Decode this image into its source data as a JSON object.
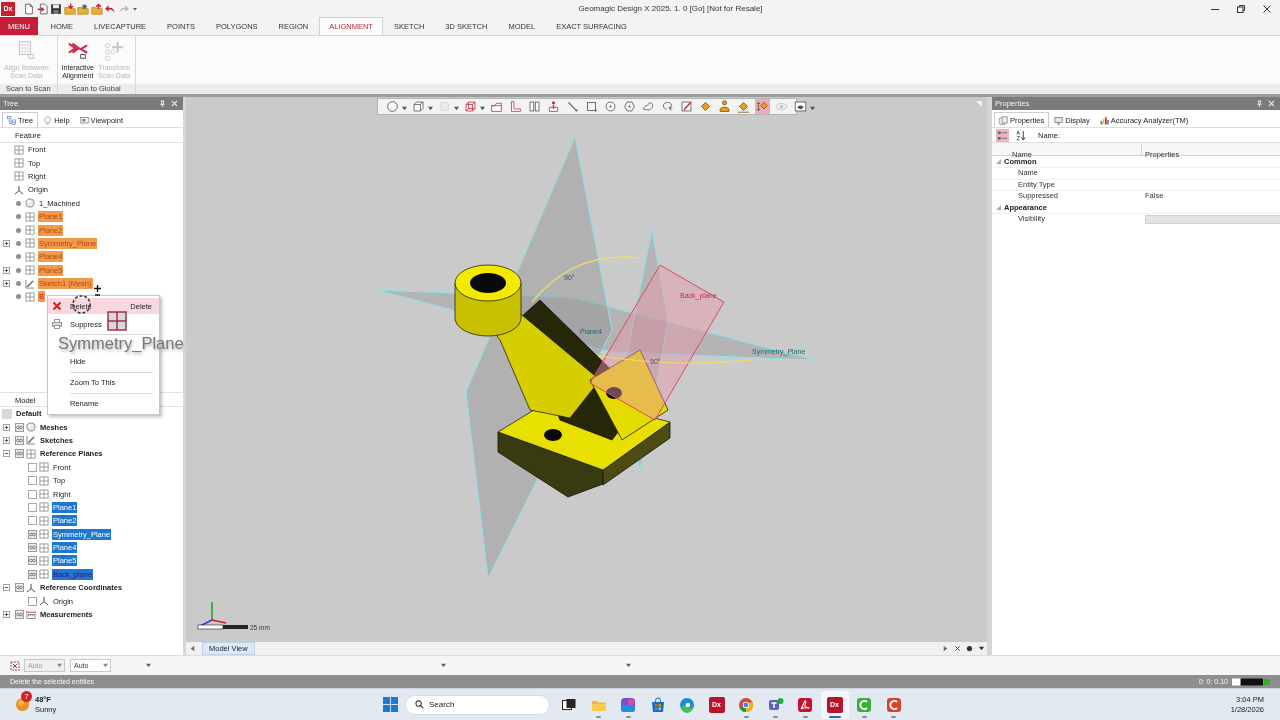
{
  "title_bar": {
    "app_badge": "Dx",
    "quick_access": [
      {
        "kind": "new",
        "disabled": false
      },
      {
        "kind": "import",
        "disabled": false
      },
      {
        "kind": "save",
        "disabled": false
      },
      {
        "kind": "folderin",
        "disabled": false
      },
      {
        "kind": "folderopen",
        "disabled": false
      },
      {
        "kind": "folderout",
        "disabled": false
      },
      {
        "kind": "undo",
        "disabled": false
      },
      {
        "kind": "redo",
        "disabled": true
      },
      {
        "kind": "customize",
        "disabled": false
      }
    ],
    "title": "Geomagic Design X 2025. 1. 0 [Go] [Not for Resale]"
  },
  "ribbon": {
    "tabs": [
      {
        "label": "MENU",
        "kind": "menu",
        "selected": false
      },
      {
        "label": "HOME",
        "kind": "tab",
        "selected": false
      },
      {
        "label": "LIVECAPTURE",
        "kind": "tab",
        "selected": false
      },
      {
        "label": "POINTS",
        "kind": "tab",
        "selected": false
      },
      {
        "label": "POLYGONS",
        "kind": "tab",
        "selected": false
      },
      {
        "label": "REGION",
        "kind": "tab",
        "selected": false
      },
      {
        "label": "ALIGNMENT",
        "kind": "tab",
        "selected": true
      },
      {
        "label": "SKETCH",
        "kind": "tab",
        "selected": false
      },
      {
        "label": "3D SKETCH",
        "kind": "tab",
        "selected": false
      },
      {
        "label": "MODEL",
        "kind": "tab",
        "selected": false
      },
      {
        "label": "EXACT SURFACING",
        "kind": "tab",
        "selected": false
      }
    ],
    "groups": [
      {
        "label": "Scan to Scan",
        "buttons": [
          {
            "kind": "grid",
            "lines": [
              "Align Between",
              "Scan Data"
            ],
            "disabled": true
          }
        ]
      },
      {
        "label": "Scan to Global",
        "buttons": [
          {
            "kind": "arrows",
            "lines": [
              "Interactive",
              "Alignment"
            ],
            "disabled": false
          },
          {
            "kind": "move",
            "lines": [
              "Transform",
              "Scan Data"
            ],
            "disabled": true
          }
        ]
      }
    ]
  },
  "tree_panel": {
    "title": "Tree",
    "tabs": [
      {
        "label": "Tree",
        "kind": "tree",
        "selected": true
      },
      {
        "label": "Help",
        "kind": "help",
        "selected": false
      },
      {
        "label": "Viewpoint",
        "kind": "viewpoint",
        "selected": false
      }
    ],
    "feature_heading": "Feature",
    "features": [
      {
        "label": "Front",
        "kind": "plane",
        "status_dot": false,
        "selected": false,
        "current": false
      },
      {
        "label": "Top",
        "kind": "plane",
        "status_dot": false,
        "selected": false,
        "current": false
      },
      {
        "label": "Right",
        "kind": "plane",
        "status_dot": false,
        "selected": false,
        "current": false
      },
      {
        "label": "Origin",
        "kind": "origin",
        "status_dot": false,
        "selected": false,
        "current": false
      },
      {
        "label": "1_Machined",
        "kind": "mesh",
        "status_dot": true,
        "selected": false,
        "current": false
      },
      {
        "label": "Plane1",
        "kind": "plane",
        "status_dot": true,
        "selected": true,
        "current": false
      },
      {
        "label": "Plane2",
        "kind": "plane",
        "status_dot": true,
        "selected": true,
        "current": false
      },
      {
        "label": "Symmetry_Plane",
        "kind": "plane",
        "status_dot": true,
        "expanded": false,
        "selected": true,
        "current": false
      },
      {
        "label": "Plane4",
        "kind": "plane",
        "status_dot": true,
        "selected": true,
        "current": false
      },
      {
        "label": "Plane5",
        "kind": "plane",
        "status_dot": true,
        "expanded": false,
        "selected": true,
        "current": false
      },
      {
        "label": "Sketch1 (Mesh)",
        "kind": "sketch",
        "status_dot": true,
        "expanded": false,
        "selected": true,
        "current": false
      },
      {
        "label": "B",
        "kind": "plane",
        "status_dot": true,
        "selected": true,
        "current": true
      }
    ],
    "model_heading": "Model",
    "model_root": "Default",
    "model_tree": [
      {
        "label": "Meshes",
        "kind": "mesh",
        "expanded": false,
        "visible": true,
        "selected": false
      },
      {
        "label": "Sketches",
        "kind": "sketch",
        "expanded": false,
        "visible": true,
        "selected": false
      },
      {
        "label": "Reference Planes",
        "kind": "plane",
        "expanded": true,
        "visible": true,
        "selected": false,
        "children": [
          {
            "label": "Front",
            "kind": "plane",
            "visible": false,
            "selected": false,
            "current": false
          },
          {
            "label": "Top",
            "kind": "plane",
            "visible": false,
            "selected": false,
            "current": false
          },
          {
            "label": "Right",
            "kind": "plane",
            "visible": false,
            "selected": false,
            "current": false
          },
          {
            "label": "Plane1",
            "kind": "plane",
            "visible": false,
            "selected": true,
            "current": false
          },
          {
            "label": "Plane2",
            "kind": "plane",
            "visible": false,
            "selected": true,
            "current": false
          },
          {
            "label": "Symmetry_Plane",
            "kind": "plane",
            "visible": true,
            "selected": true,
            "current": false
          },
          {
            "label": "Plane4",
            "kind": "plane",
            "visible": true,
            "selected": true,
            "current": false
          },
          {
            "label": "Plane5",
            "kind": "plane",
            "visible": true,
            "selected": true,
            "current": false
          },
          {
            "label": "Back_plane",
            "kind": "plane",
            "visible": true,
            "selected": true,
            "current": true
          }
        ]
      },
      {
        "label": "Reference Coordinates",
        "kind": "origin",
        "expanded": true,
        "visible": true,
        "selected": false,
        "children": [
          {
            "label": "Origin",
            "kind": "origin",
            "visible": false,
            "selected": false,
            "current": false
          }
        ]
      },
      {
        "label": "Measurements",
        "kind": "measure",
        "expanded": false,
        "visible": true,
        "selected": false
      }
    ]
  },
  "context_menu": {
    "items": [
      {
        "kind": "delete",
        "label": "Delete",
        "shortcut": "Delete",
        "highlighted": true,
        "separator": false
      },
      {
        "kind": "suppress",
        "label": "Suppress",
        "highlighted": false,
        "separator": false
      },
      {
        "kind": "plain",
        "label": "Hide",
        "highlighted": false,
        "separator": true
      },
      {
        "kind": "plain",
        "label": "Zoom To This",
        "highlighted": false,
        "separator": true
      },
      {
        "kind": "plain",
        "label": "Rename",
        "highlighted": false,
        "separator": true
      }
    ]
  },
  "drag_ghost": {
    "label": "Symmetry_Plane"
  },
  "viewport": {
    "toolbar": [
      {
        "kind": "sphere",
        "dropdown": true,
        "selected": false,
        "disabled": false
      },
      {
        "kind": "cube",
        "dropdown": true,
        "selected": false,
        "disabled": false
      },
      {
        "kind": "surface",
        "dropdown": true,
        "selected": false,
        "disabled": true
      },
      {
        "kind": "wireframe",
        "dropdown": true,
        "selected": false,
        "disabled": false
      },
      {
        "kind": "front",
        "dropdown": false,
        "selected": false,
        "disabled": false
      },
      {
        "kind": "top",
        "dropdown": false,
        "selected": false,
        "disabled": false
      },
      {
        "kind": "side",
        "dropdown": false,
        "selected": false,
        "disabled": false
      },
      {
        "kind": "normal",
        "dropdown": false,
        "selected": false,
        "disabled": false
      },
      {
        "kind": "line",
        "dropdown": false,
        "selected": false,
        "disabled": false
      },
      {
        "kind": "rectangle",
        "dropdown": false,
        "selected": false,
        "disabled": false
      },
      {
        "kind": "circle",
        "dropdown": false,
        "selected": false,
        "disabled": false
      },
      {
        "kind": "hexagon",
        "dropdown": false,
        "selected": false,
        "disabled": false
      },
      {
        "kind": "freeform",
        "dropdown": false,
        "selected": false,
        "disabled": false
      },
      {
        "kind": "lasso",
        "dropdown": false,
        "selected": false,
        "disabled": false
      },
      {
        "kind": "brush",
        "dropdown": false,
        "selected": false,
        "disabled": false
      },
      {
        "kind": "bucket",
        "dropdown": false,
        "selected": false,
        "disabled": false
      },
      {
        "kind": "bucketperson",
        "dropdown": false,
        "selected": false,
        "disabled": false
      },
      {
        "kind": "bucketline",
        "dropdown": false,
        "selected": false,
        "disabled": false
      },
      {
        "kind": "bucketarrows",
        "dropdown": false,
        "selected": true,
        "disabled": false
      },
      {
        "kind": "eye",
        "dropdown": false,
        "selected": false,
        "disabled": true
      },
      {
        "kind": "screen",
        "dropdown": true,
        "selected": false,
        "disabled": false
      }
    ],
    "angle_labels": [
      "90°",
      "90°"
    ],
    "plane_labels": [
      {
        "text": "Back_plane",
        "current": true
      },
      {
        "text": "Symmetry_Plane",
        "current": false
      },
      {
        "text": "Plane4",
        "current": false
      }
    ],
    "scale_label": "25 mm"
  },
  "view_tabs": [
    {
      "label": "Model View",
      "selected": true
    }
  ],
  "properties_panel": {
    "title": "Properties",
    "tabs": [
      {
        "label": "Properties",
        "kind": "properties",
        "selected": true
      },
      {
        "label": "Display",
        "kind": "display",
        "selected": false
      },
      {
        "label": "Accuracy Analyzer(TM)",
        "kind": "accuracy",
        "selected": false
      }
    ],
    "sort_buttons": [
      {
        "kind": "categorized",
        "selected": true
      },
      {
        "kind": "alphabetical",
        "selected": false
      }
    ],
    "name_label": "Name:",
    "columns": [
      "Name",
      "Properties"
    ],
    "groups": [
      {
        "label": "Common",
        "expanded": true,
        "rows": [
          {
            "name": "Name",
            "kind": "text"
          },
          {
            "name": "Entity Type",
            "kind": "text"
          },
          {
            "name": "Suppressed",
            "kind": "text",
            "value": "False"
          }
        ]
      },
      {
        "label": "Appearance",
        "expanded": true,
        "rows": [
          {
            "name": "Visibility",
            "kind": "field"
          }
        ]
      }
    ]
  },
  "status_toolbar": {
    "fields": [
      {
        "value": "Auto",
        "disabled": true
      },
      {
        "value": "Auto",
        "disabled": false
      }
    ]
  },
  "status_bar": {
    "message": "Delete the selected entities",
    "coordinates": "0: 0: 0.10"
  },
  "taskbar": {
    "weather": {
      "temperature": "48°F",
      "condition": "Sunny",
      "badge": "7"
    },
    "search_label": "Search",
    "apps": [
      {
        "kind": "taskview",
        "running": false,
        "active": false
      },
      {
        "kind": "explorer",
        "running": true,
        "active": false
      },
      {
        "kind": "m365",
        "running": true,
        "active": false
      },
      {
        "kind": "store",
        "running": false,
        "active": false
      },
      {
        "kind": "edge",
        "running": false,
        "active": false
      },
      {
        "kind": "dx",
        "label": "Dx",
        "running": false,
        "active": false
      },
      {
        "kind": "chrome",
        "running": true,
        "active": false
      },
      {
        "kind": "teams",
        "running": true,
        "active": false
      },
      {
        "kind": "acrobat",
        "running": true,
        "active": false
      },
      {
        "kind": "dx",
        "label": "Dx",
        "running": true,
        "active": true
      },
      {
        "kind": "greenc",
        "running": true,
        "active": false
      },
      {
        "kind": "redc",
        "running": true,
        "active": false
      }
    ],
    "time": "3:04 PM",
    "date": "1/28/2026"
  }
}
